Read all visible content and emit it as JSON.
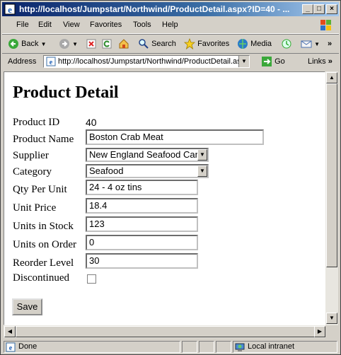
{
  "window": {
    "title": "http://localhost/Jumpstart/Northwind/ProductDetail.aspx?ID=40 - ...",
    "minimize": "_",
    "maximize": "□",
    "close": "×"
  },
  "menu": [
    "File",
    "Edit",
    "View",
    "Favorites",
    "Tools",
    "Help"
  ],
  "toolbar": {
    "back_label": "Back",
    "search_label": "Search",
    "favorites_label": "Favorites",
    "media_label": "Media",
    "more": "»"
  },
  "address": {
    "label": "Address",
    "url": "http://localhost/Jumpstart/Northwind/ProductDetail.asp",
    "go_label": "Go",
    "links_label": "Links",
    "more": "»"
  },
  "page": {
    "heading": "Product Detail",
    "fields": {
      "product_id": {
        "label": "Product ID",
        "value": "40"
      },
      "product_name": {
        "label": "Product Name",
        "value": "Boston Crab Meat"
      },
      "supplier": {
        "label": "Supplier",
        "value": "New England Seafood Can"
      },
      "category": {
        "label": "Category",
        "value": "Seafood"
      },
      "qty_per_unit": {
        "label": "Qty Per Unit",
        "value": "24 - 4 oz tins"
      },
      "unit_price": {
        "label": "Unit Price",
        "value": "18.4"
      },
      "units_in_stock": {
        "label": "Units in Stock",
        "value": "123"
      },
      "units_on_order": {
        "label": "Units on Order",
        "value": "0"
      },
      "reorder_level": {
        "label": "Reorder Level",
        "value": "30"
      },
      "discontinued": {
        "label": "Discontinued",
        "checked": false
      }
    },
    "save_label": "Save"
  },
  "status": {
    "text": "Done",
    "zone": "Local intranet"
  }
}
